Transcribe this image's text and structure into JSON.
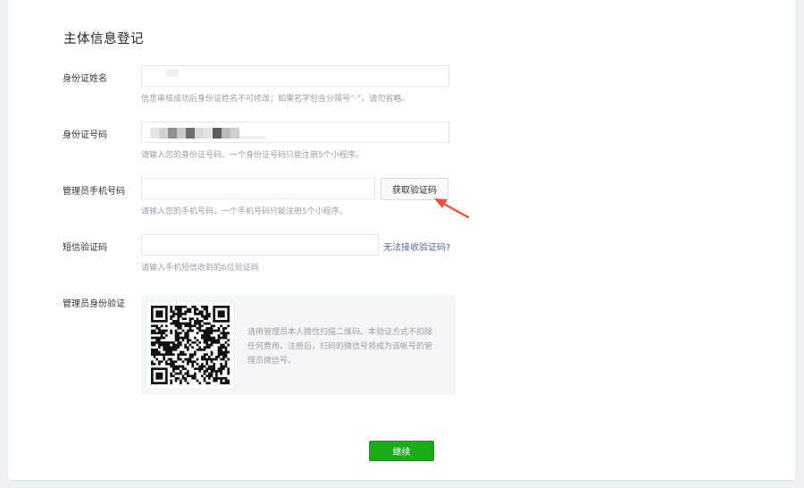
{
  "page": {
    "title": "主体信息登记"
  },
  "form": {
    "name": {
      "label": "身份证姓名",
      "value": "",
      "hint": "信息审核成功后身份证姓名不可修改；如果名字包含分隔号“·”，请勿省略。"
    },
    "id_number": {
      "label": "身份证号码",
      "value": "",
      "hint": "请输入您的身份证号码。一个身份证号码只能注册5个小程序。"
    },
    "phone": {
      "label": "管理员手机号码",
      "value": "",
      "get_code_button": "获取验证码",
      "hint": "请输入您的手机号码，一个手机号码只能注册5个小程序。"
    },
    "sms_code": {
      "label": "短信验证码",
      "value": "",
      "no_code_link": "无法接收验证码?",
      "hint": "请输入手机短信收到的6位验证码"
    },
    "admin_verify": {
      "label": "管理员身份验证",
      "qr_description": "请用管理员本人微信扫描二维码。本验证方式不扣除任何费用。注册后，扫码的微信号将成为该帐号的管理员微信号。"
    }
  },
  "actions": {
    "continue_label": "继续"
  },
  "colors": {
    "primary_green": "#1aad19",
    "link_blue": "#576b95",
    "annotation_red": "#e8553a"
  }
}
